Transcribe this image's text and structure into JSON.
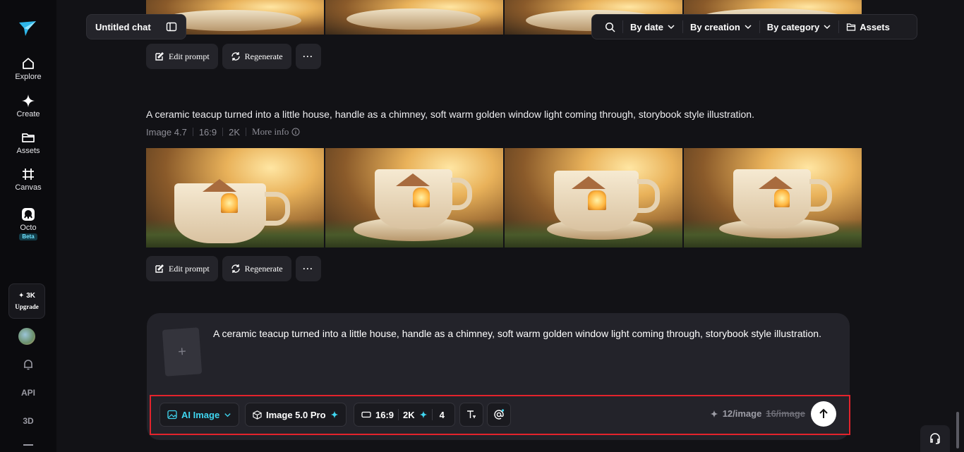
{
  "sidebar": {
    "nav": [
      {
        "label": "Explore",
        "icon": "home-icon"
      },
      {
        "label": "Create",
        "icon": "sparkle-icon"
      },
      {
        "label": "Assets",
        "icon": "folder-icon"
      },
      {
        "label": "Canvas",
        "icon": "grid-hash-icon"
      },
      {
        "label": "Octo",
        "icon": "octo-icon",
        "badge": "Beta"
      }
    ],
    "credits": "3K",
    "upgrade_label": "Upgrade",
    "api_label": "API",
    "three_d_label": "3D"
  },
  "header": {
    "chat_title": "Untitled chat",
    "filters": {
      "by_date": "By date",
      "by_creation": "By creation",
      "by_category": "By category",
      "assets": "Assets"
    }
  },
  "gallery": {
    "actions": {
      "edit": "Edit prompt",
      "regenerate": "Regenerate",
      "more": "···"
    },
    "generation": {
      "prompt": "A ceramic teacup turned into a little house, handle as a chimney, soft warm golden window light coming through, storybook style illustration.",
      "model": "Image 4.7",
      "ratio": "16:9",
      "resolution": "2K",
      "more_info": "More info"
    }
  },
  "composer": {
    "text": "A ceramic teacup turned into a little house, handle as a chimney, soft warm golden window light coming through, storybook style illustration.",
    "attach_symbol": "+",
    "toolbar": {
      "mode": "AI Image",
      "model": "Image 5.0 Pro",
      "ratio": "16:9",
      "resolution": "2K",
      "count": "4",
      "cost": "12/image",
      "old_cost": "16/image"
    }
  },
  "colors": {
    "accent": "#3fd5ef",
    "highlight_border": "#e3232c",
    "background": "#121216"
  }
}
